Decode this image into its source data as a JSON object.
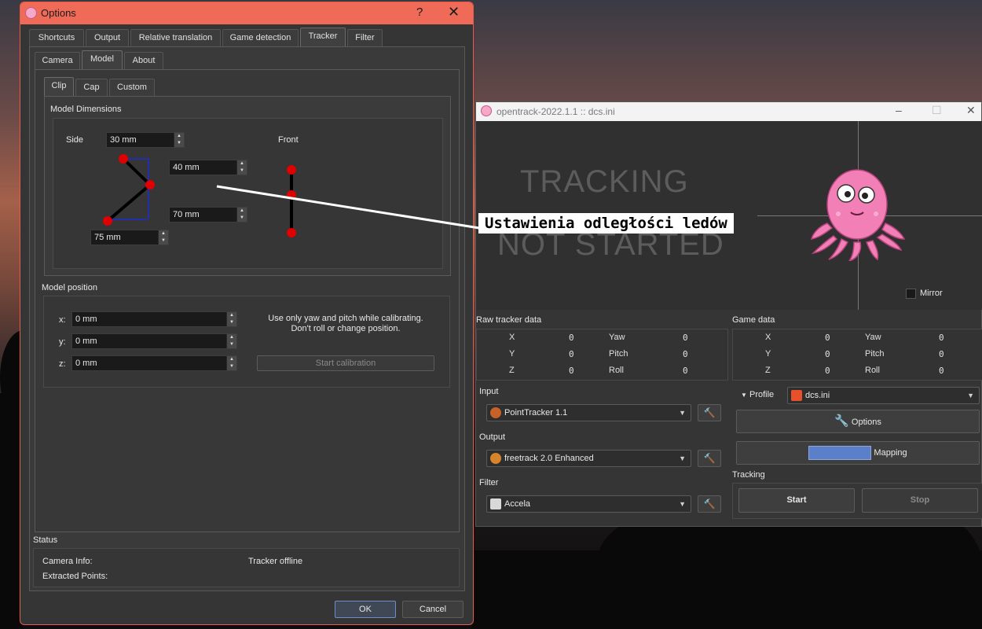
{
  "options_window": {
    "title": "Options",
    "help_glyph": "?",
    "close_glyph": "✕",
    "tabs": [
      "Shortcuts",
      "Output",
      "Relative translation",
      "Game detection",
      "Tracker",
      "Filter"
    ],
    "subtabs": [
      "Camera",
      "Model",
      "About"
    ],
    "model_tabs": [
      "Clip",
      "Cap",
      "Custom"
    ],
    "model_dimensions": {
      "title": "Model Dimensions",
      "side_label": "Side",
      "front_label": "Front",
      "side_value": "30 mm",
      "upper_value": "40 mm",
      "lower_value": "70 mm",
      "bottom_value": "75 mm"
    },
    "model_position": {
      "title": "Model position",
      "x_label": "x:",
      "y_label": "y:",
      "z_label": "z:",
      "x_value": "0 mm",
      "y_value": "0 mm",
      "z_value": "0 mm",
      "hint_line1": "Use only yaw and pitch while calibrating.",
      "hint_line2": "Don't roll or change position.",
      "calibrate_label": "Start calibration"
    },
    "status": {
      "title": "Status",
      "camera_info_label": "Camera Info:",
      "extracted_points_label": "Extracted Points:",
      "tracker_status": "Tracker offline"
    },
    "ok_label": "OK",
    "cancel_label": "Cancel"
  },
  "main_window": {
    "title": "opentrack-2022.1.1 :: dcs.ini",
    "tracking_line1": "TRACKING",
    "tracking_line2": "NOT STARTED",
    "mirror_label": "Mirror",
    "raw_tracker_title": "Raw tracker data",
    "game_data_title": "Game data",
    "raw": {
      "x_label": "X",
      "y_label": "Y",
      "z_label": "Z",
      "yaw_label": "Yaw",
      "pitch_label": "Pitch",
      "roll_label": "Roll",
      "x": "0",
      "y": "0",
      "z": "0",
      "yaw": "0",
      "pitch": "0",
      "roll": "0"
    },
    "game": {
      "x_label": "X",
      "y_label": "Y",
      "z_label": "Z",
      "yaw_label": "Yaw",
      "pitch_label": "Pitch",
      "roll_label": "Roll",
      "x": "0",
      "y": "0",
      "z": "0",
      "yaw": "0",
      "pitch": "0",
      "roll": "0"
    },
    "input_title": "Input",
    "input_value": "PointTracker 1.1",
    "output_title": "Output",
    "output_value": "freetrack 2.0 Enhanced",
    "filter_title": "Filter",
    "filter_value": "Accela",
    "profile_label": "Profile",
    "profile_value": "dcs.ini",
    "options_label": "Options",
    "mapping_label": "Mapping",
    "tracking_title": "Tracking",
    "start_label": "Start",
    "stop_label": "Stop"
  },
  "callout_text": "Ustawienia odległości ledów",
  "colors": {
    "accent_title": "#ef6b57",
    "led_red": "#e00000",
    "guide_blue": "#1a2fd0"
  }
}
